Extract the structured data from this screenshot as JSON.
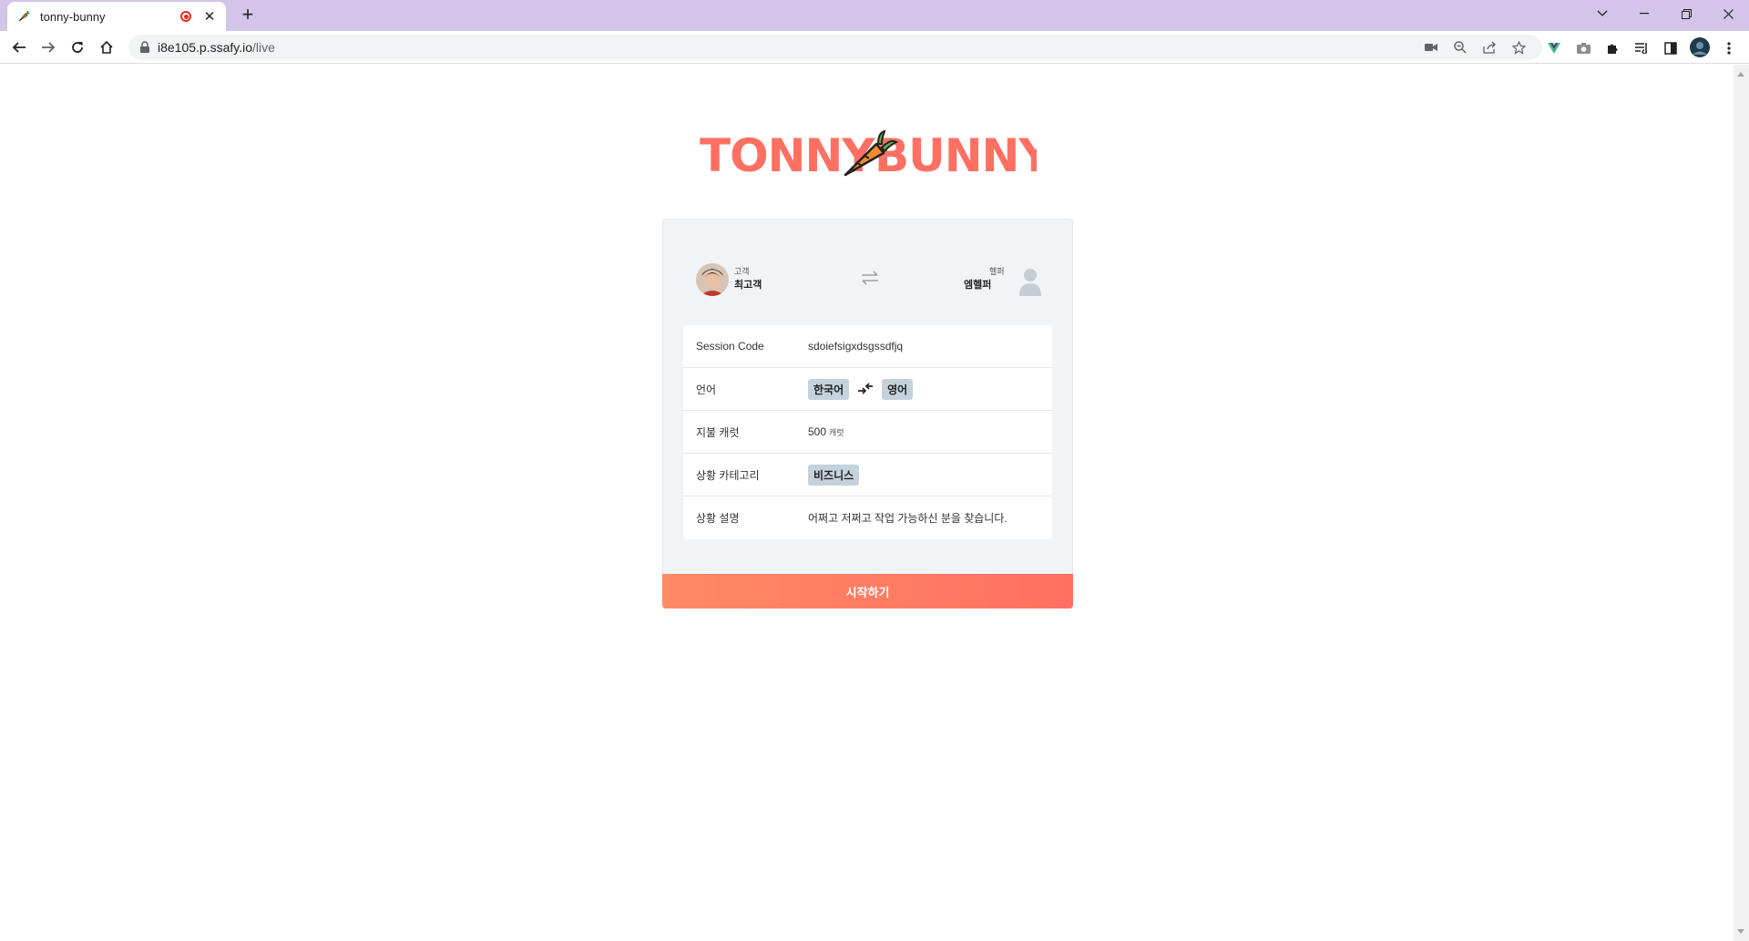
{
  "browser": {
    "tab_title": "tonny-bunny",
    "url_host": "i8e105.p.ssafy.io",
    "url_path": "/live"
  },
  "logo_text": "TONNY BUNNY",
  "participants": {
    "customer_role": "고객",
    "customer_name": "최고객",
    "helper_role": "헬퍼",
    "helper_name": "엠헬퍼"
  },
  "details": {
    "session_code_label": "Session Code",
    "session_code_value": "sdoiefsigxdsgssdfjq",
    "language_label": "언어",
    "language_from": "한국어",
    "language_to": "영어",
    "payment_label": "지불 캐럿",
    "payment_value": "500",
    "payment_unit": "캐럿",
    "category_label": "상황 카테고리",
    "category_value": "비즈니스",
    "description_label": "상황 설명",
    "description_value": "어쩌고 저쩌고 작업 가능하신 분을 찾습니다."
  },
  "start_button": "시작하기",
  "colors": {
    "tab_strip": "#d3c5ea",
    "accent": "#ff7d63",
    "chip": "#c5d2dc",
    "card": "#f1f4f7"
  }
}
